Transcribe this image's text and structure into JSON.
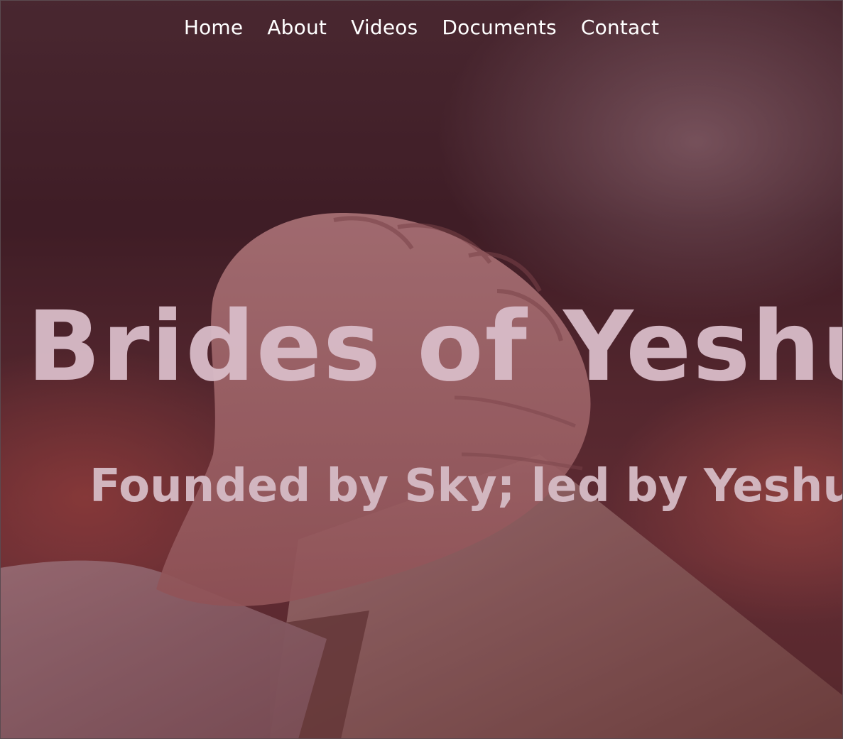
{
  "nav": {
    "items": [
      {
        "label": "Home"
      },
      {
        "label": "About"
      },
      {
        "label": "Videos"
      },
      {
        "label": "Documents"
      },
      {
        "label": "Contact"
      }
    ]
  },
  "hero": {
    "title": "Brides of Yeshua",
    "subtitle": "Founded by Sky; led by Yeshua",
    "image": "praying-hands-photo"
  },
  "colors": {
    "title_text": "#d9bcc8",
    "nav_text": "#ffffff",
    "overlay": "#4a2a32"
  }
}
